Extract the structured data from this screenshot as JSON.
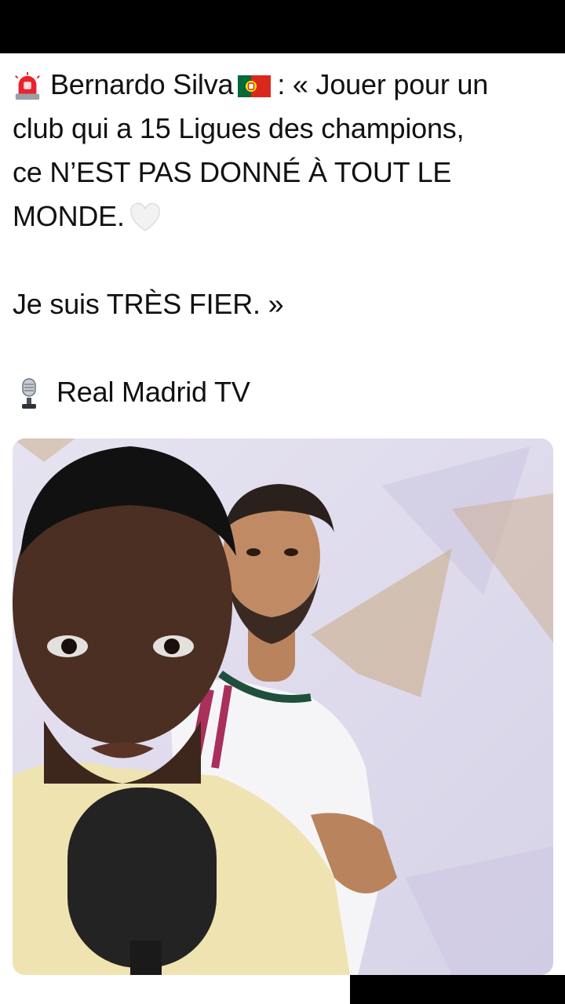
{
  "post": {
    "line1_name": "Bernardo Silva",
    "line1_rest": ": « Jouer pour un",
    "line2": "club qui a 15 Ligues des champions,",
    "line3": "ce N’EST PAS DONNÉ À TOUT LE",
    "line4": "MONDE.",
    "line5": "Je suis TRÈS FIER. »",
    "source": "Real Madrid TV"
  },
  "icons": {
    "siren": "police-light-icon",
    "flag": "portugal-flag-icon",
    "heart": "white-heart-icon",
    "mic": "microphone-icon"
  },
  "colors": {
    "text": "#111111",
    "media_bg": "#ddd9ec",
    "bars": "#000000"
  }
}
